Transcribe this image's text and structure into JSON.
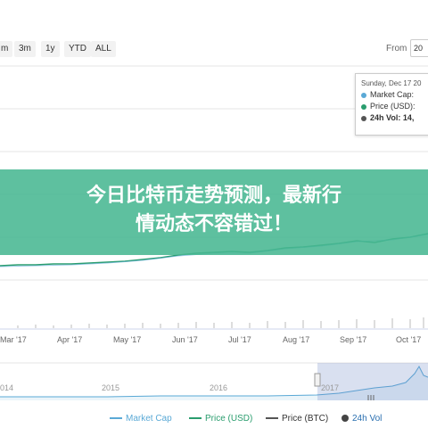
{
  "range_buttons": [
    "m",
    "3m",
    "1y",
    "YTD",
    "ALL"
  ],
  "from": {
    "label": "From",
    "value": "20"
  },
  "tooltip": {
    "date": "Sunday, Dec 17 20",
    "rows": [
      {
        "label": "Market Cap:",
        "color": "#5aa9d6"
      },
      {
        "label": "Price (USD):",
        "color": "#2a9d6e"
      },
      {
        "label": "24h Vol: 14,",
        "color": "#555555"
      }
    ]
  },
  "banner": {
    "line1": "今日比特币走势预测，最新行",
    "line2": "情动态不容错过！",
    "color": "#48b792"
  },
  "months": [
    "Mar '17",
    "Apr '17",
    "May '17",
    "Jun '17",
    "Jul '17",
    "Aug '17",
    "Sep '17",
    "Oct '17"
  ],
  "years": [
    "014",
    "2015",
    "2016",
    "2017"
  ],
  "legend": [
    {
      "label": "Market Cap",
      "color": "#5aa9d6"
    },
    {
      "label": "Price (USD)",
      "color": "#2a9d6e"
    },
    {
      "label": "Price (BTC)",
      "color": "#555555"
    },
    {
      "label": "24h Vol",
      "color": "#444444"
    }
  ]
}
